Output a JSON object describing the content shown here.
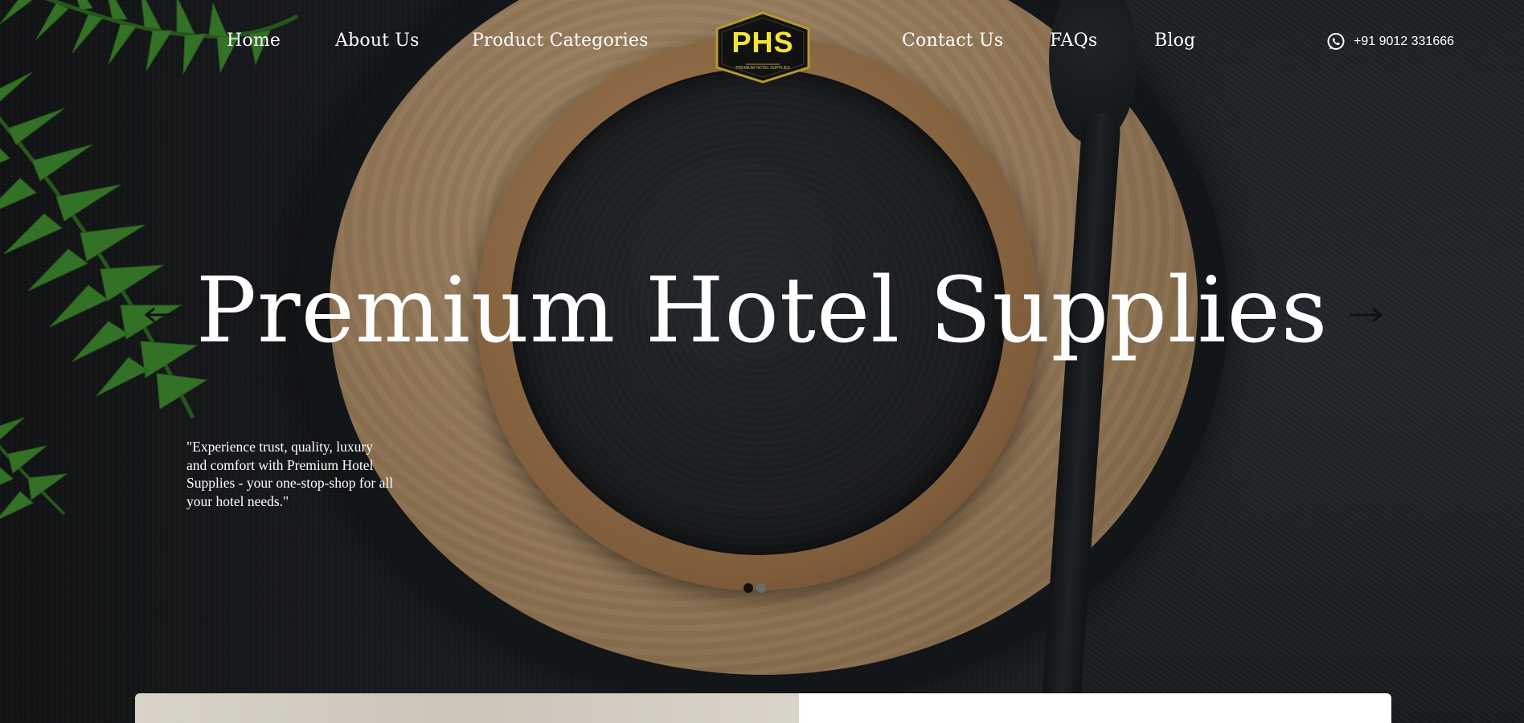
{
  "nav": {
    "home": "Home",
    "about": "About Us",
    "categories": "Product Categories",
    "contact": "Contact Us",
    "faqs": "FAQs",
    "blog": "Blog"
  },
  "logo": {
    "text": "PHS",
    "subtitle": "PREMIUM HOTEL SUPPLIES"
  },
  "phone": {
    "number": "+91 9012 331666",
    "icon": "whatsapp-icon"
  },
  "hero": {
    "title": "Premium Hotel Supplies",
    "tagline": "\"Experience trust, quality, luxury and comfort with Premium Hotel Supplies - your one-stop-shop for all your hotel needs.\"",
    "prev_icon": "arrow-left-icon",
    "next_icon": "arrow-right-icon",
    "slides_total": 2,
    "active_slide": 1
  },
  "colors": {
    "logo_accent": "#f4e52a",
    "text": "#ffffff",
    "dot_active": "#111111",
    "dot_inactive": "#6b6b6b"
  }
}
